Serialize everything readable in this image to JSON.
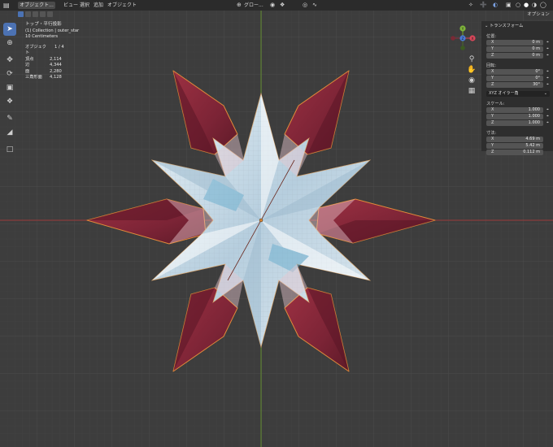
{
  "header": {
    "editor_icon": "viewport-icon",
    "mode": "オブジェクト...",
    "menus": [
      "ビュー",
      "選択",
      "追加",
      "オブジェクト"
    ],
    "transform_orientation": "グロー...",
    "options_label": "オプション"
  },
  "overlay": {
    "view_name": "トップ・平行投影",
    "collection": "(1) Collection | outer_star",
    "scale": "10 Centimeters",
    "stats": [
      {
        "label": "オブジェクト",
        "value": "1 / 4"
      },
      {
        "label": "頂点",
        "value": "2,114"
      },
      {
        "label": "辺",
        "value": "4,344"
      },
      {
        "label": "面",
        "value": "2,280"
      },
      {
        "label": "三角形面",
        "value": "4,128"
      }
    ]
  },
  "gizmo_axes": [
    "Y",
    "X",
    "Z"
  ],
  "npanel": {
    "title": "トランスフォーム",
    "location_label": "位置:",
    "location": [
      {
        "axis": "X",
        "value": "0 m"
      },
      {
        "axis": "Y",
        "value": "0 m"
      },
      {
        "axis": "Z",
        "value": "0 m"
      }
    ],
    "rotation_label": "回転:",
    "rotation": [
      {
        "axis": "X",
        "value": "0°"
      },
      {
        "axis": "Y",
        "value": "0°"
      },
      {
        "axis": "Z",
        "value": "30°"
      }
    ],
    "rotation_mode": "XYZ オイラー角",
    "scale_label": "スケール:",
    "scale": [
      {
        "axis": "X",
        "value": "1.000"
      },
      {
        "axis": "Y",
        "value": "1.000"
      },
      {
        "axis": "Z",
        "value": "1.000"
      }
    ],
    "dimensions_label": "寸法:",
    "dimensions": [
      {
        "axis": "X",
        "value": "4.69 m"
      },
      {
        "axis": "Y",
        "value": "5.42 m"
      },
      {
        "axis": "Z",
        "value": "0.112 m"
      }
    ]
  },
  "colors": {
    "background": "#3d3d3d",
    "grid": "#474747",
    "x_axis": "#9a3a3a",
    "y_axis": "#5e8a2a",
    "petal": "#8a2b3c",
    "selection_outline": "#e08a3a",
    "star": "#c7d7e3"
  }
}
